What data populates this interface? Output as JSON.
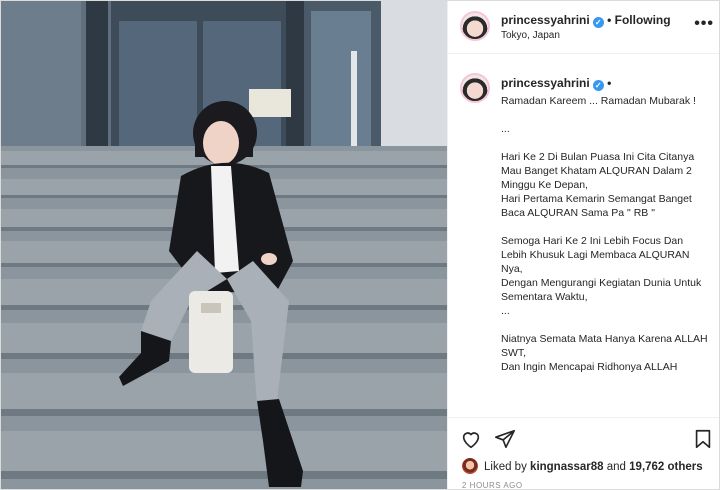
{
  "post": {
    "username": "princessyahrini",
    "follow_status": "Following",
    "location": "Tokyo, Japan",
    "caption_username": "princessyahrini",
    "caption_text": "Ramadan Kareem ... Ramadan Mubarak !\n\n...\n\nHari Ke 2 Di Bulan Puasa Ini Cita Citanya Mau Banget Khatam ALQURAN Dalam 2 Minggu Ke Depan,\nHari Pertama Kemarin Semangat Banget Baca ALQURAN Sama Pa \" RB \"\n\nSemoga Hari Ke 2 Ini Lebih Focus Dan Lebih Khusuk Lagi Membaca ALQURAN Nya,\nDengan Mengurangi Kegiatan Dunia Untuk Sementara Waktu,\n...\n\nNiatnya Semata Mata Hanya Karena ALLAH SWT,\nDan Ingin Mencapai Ridhonya ALLAH",
    "liked_by_prefix": "Liked by",
    "liked_by_user": "kingnassar88",
    "liked_by_and": "and",
    "liked_by_others": "19,762 others",
    "timestamp": "2 HOURS AGO"
  },
  "icons": {
    "verified": "verified-badge-icon",
    "more": "more-options-icon",
    "like": "heart-icon",
    "share": "share-icon",
    "save": "bookmark-icon"
  },
  "colors": {
    "verified_blue": "#3897f0",
    "text": "#262626",
    "muted": "#8e8e8e",
    "border": "#efefef"
  }
}
